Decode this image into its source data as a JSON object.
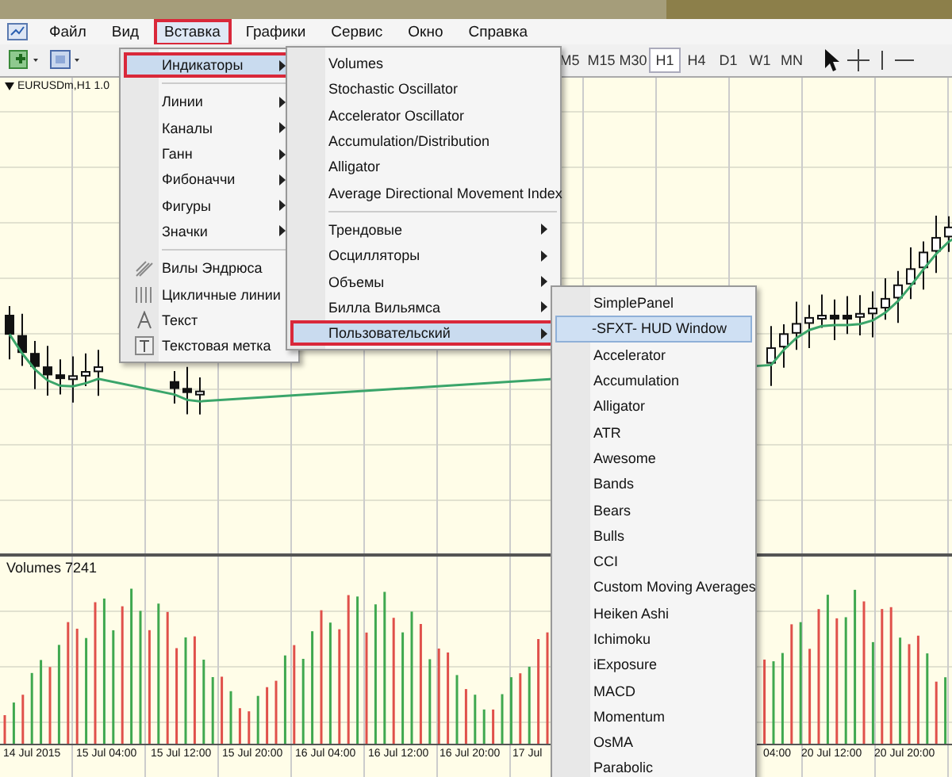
{
  "menubar": [
    {
      "label": "Файл",
      "selected": false
    },
    {
      "label": "Вид",
      "selected": false
    },
    {
      "label": "Вставка",
      "selected": true
    },
    {
      "label": "Графики",
      "selected": false
    },
    {
      "label": "Сервис",
      "selected": false
    },
    {
      "label": "Окно",
      "selected": false
    },
    {
      "label": "Справка",
      "selected": false
    }
  ],
  "toolbar": {
    "timeframes": [
      {
        "label": "M5",
        "selected": false
      },
      {
        "label": "M15",
        "selected": false
      },
      {
        "label": "M30",
        "selected": false
      },
      {
        "label": "H1",
        "selected": true
      },
      {
        "label": "H4",
        "selected": false
      },
      {
        "label": "D1",
        "selected": false
      },
      {
        "label": "W1",
        "selected": false
      },
      {
        "label": "MN",
        "selected": false
      }
    ]
  },
  "chart": {
    "symbol_label": "EURUSDm,H1 1.0",
    "volume_label": "Volumes 7241",
    "time_labels": [
      "14 Jul 2015",
      "15 Jul 04:00",
      "15 Jul 12:00",
      "15 Jul 20:00",
      "16 Jul 04:00",
      "16 Jul 12:00",
      "16 Jul 20:00",
      "17 Jul",
      "04:00",
      "20 Jul 12:00",
      "20 Jul 20:00"
    ]
  },
  "insert_menu": {
    "items": [
      {
        "kind": "item",
        "label": "Индикаторы",
        "submenu": true,
        "selected": true
      },
      {
        "kind": "separator"
      },
      {
        "kind": "item",
        "label": "Линии",
        "submenu": true,
        "selected": false
      },
      {
        "kind": "item",
        "label": "Каналы",
        "submenu": true,
        "selected": false
      },
      {
        "kind": "item",
        "label": "Ганн",
        "submenu": true,
        "selected": false
      },
      {
        "kind": "item",
        "label": "Фибоначчи",
        "submenu": true,
        "selected": false
      },
      {
        "kind": "item",
        "label": "Фигуры",
        "submenu": true,
        "selected": false
      },
      {
        "kind": "item",
        "label": "Значки",
        "submenu": true,
        "selected": false
      },
      {
        "kind": "separator"
      },
      {
        "kind": "tool",
        "label": "Вилы Эндрюса",
        "submenu": false,
        "selected": false
      },
      {
        "kind": "tool",
        "label": "Цикличные линии",
        "submenu": false,
        "selected": false
      },
      {
        "kind": "tool",
        "label": "Текст",
        "submenu": false,
        "selected": false
      },
      {
        "kind": "tool",
        "label": "Текстовая метка",
        "submenu": false,
        "selected": false
      }
    ]
  },
  "indicators_menu": {
    "items": [
      {
        "kind": "item",
        "label": "Volumes",
        "submenu": false,
        "selected": false
      },
      {
        "kind": "item",
        "label": "Stochastic Oscillator",
        "submenu": false,
        "selected": false
      },
      {
        "kind": "item",
        "label": "Accelerator Oscillator",
        "submenu": false,
        "selected": false
      },
      {
        "kind": "item",
        "label": "Accumulation/Distribution",
        "submenu": false,
        "selected": false
      },
      {
        "kind": "item",
        "label": "Alligator",
        "submenu": false,
        "selected": false
      },
      {
        "kind": "item",
        "label": "Average Directional Movement Index",
        "submenu": false,
        "selected": false
      },
      {
        "kind": "separator"
      },
      {
        "kind": "item",
        "label": "Трендовые",
        "submenu": true,
        "selected": false
      },
      {
        "kind": "item",
        "label": "Осцилляторы",
        "submenu": true,
        "selected": false
      },
      {
        "kind": "item",
        "label": "Объемы",
        "submenu": true,
        "selected": false
      },
      {
        "kind": "item",
        "label": "Билла Вильямса",
        "submenu": true,
        "selected": false
      },
      {
        "kind": "item",
        "label": "Пользовательский",
        "submenu": true,
        "selected": true
      }
    ]
  },
  "custom_menu": {
    "items": [
      {
        "kind": "item",
        "label": "SimplePanel",
        "submenu": false,
        "selected": false
      },
      {
        "kind": "item",
        "label": "-SFXT- HUD Window",
        "submenu": false,
        "selected": true
      },
      {
        "kind": "item",
        "label": "Accelerator",
        "submenu": false,
        "selected": false
      },
      {
        "kind": "item",
        "label": "Accumulation",
        "submenu": false,
        "selected": false
      },
      {
        "kind": "item",
        "label": "Alligator",
        "submenu": false,
        "selected": false
      },
      {
        "kind": "item",
        "label": "ATR",
        "submenu": false,
        "selected": false
      },
      {
        "kind": "item",
        "label": "Awesome",
        "submenu": false,
        "selected": false
      },
      {
        "kind": "item",
        "label": "Bands",
        "submenu": false,
        "selected": false
      },
      {
        "kind": "item",
        "label": "Bears",
        "submenu": false,
        "selected": false
      },
      {
        "kind": "item",
        "label": "Bulls",
        "submenu": false,
        "selected": false
      },
      {
        "kind": "item",
        "label": "CCI",
        "submenu": false,
        "selected": false
      },
      {
        "kind": "item",
        "label": "Custom Moving Averages",
        "submenu": false,
        "selected": false
      },
      {
        "kind": "item",
        "label": "Heiken Ashi",
        "submenu": false,
        "selected": false
      },
      {
        "kind": "item",
        "label": "Ichimoku",
        "submenu": false,
        "selected": false
      },
      {
        "kind": "item",
        "label": "iExposure",
        "submenu": false,
        "selected": false
      },
      {
        "kind": "item",
        "label": "MACD",
        "submenu": false,
        "selected": false
      },
      {
        "kind": "item",
        "label": "Momentum",
        "submenu": false,
        "selected": false
      },
      {
        "kind": "item",
        "label": "OsMA",
        "submenu": false,
        "selected": false
      },
      {
        "kind": "item",
        "label": "Parabolic",
        "submenu": false,
        "selected": false
      }
    ]
  }
}
